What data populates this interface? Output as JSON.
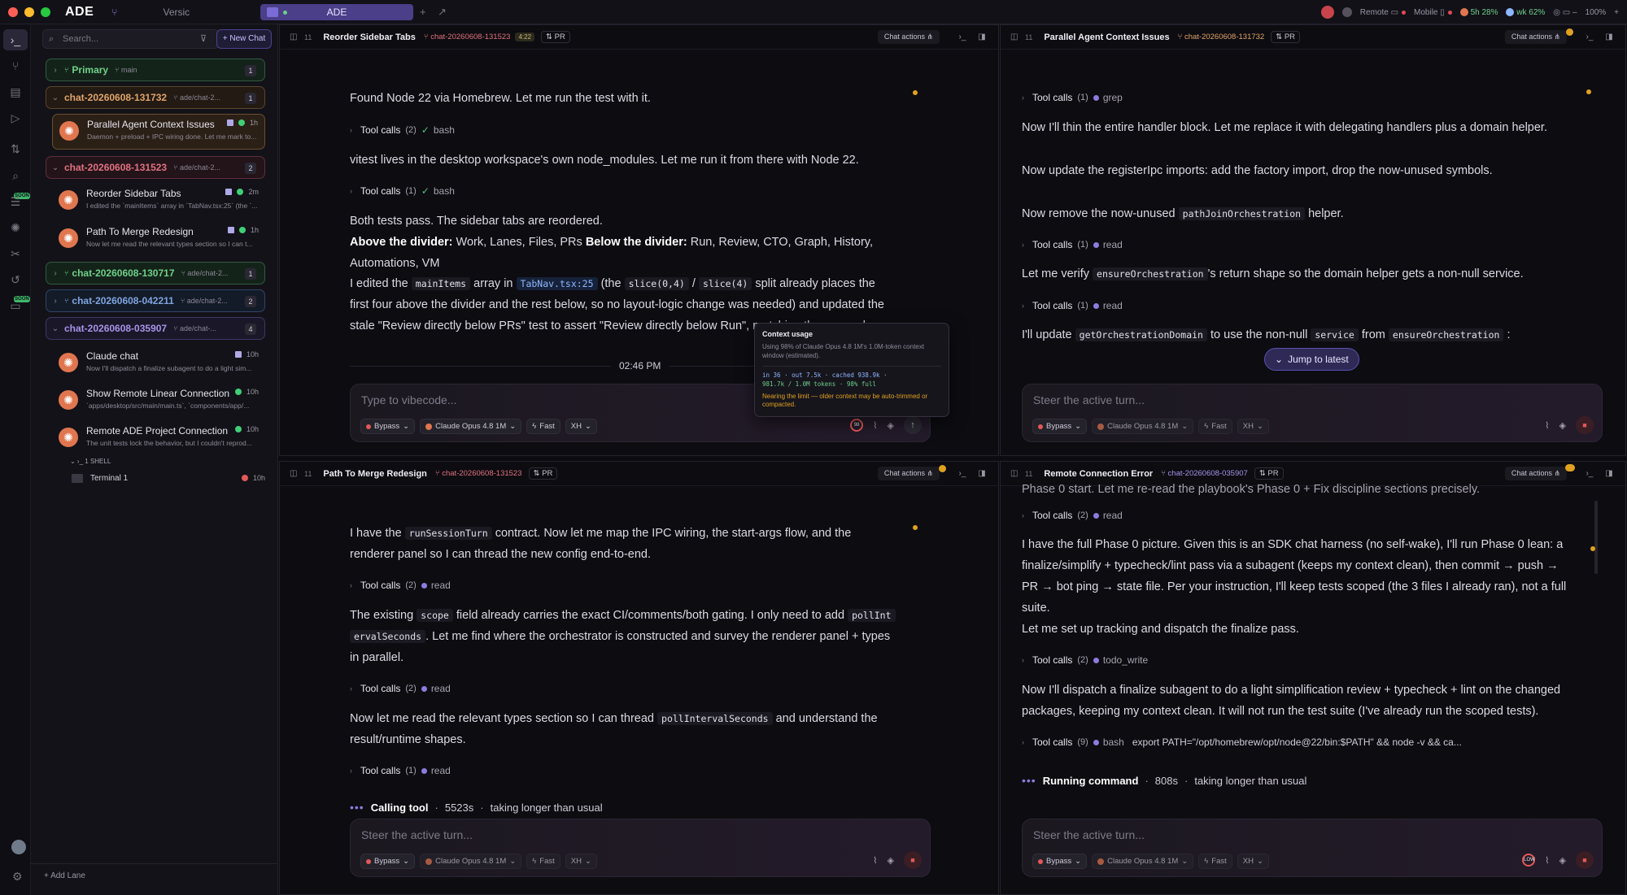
{
  "titlebar": {
    "app_name": "ADE",
    "workspace": "Versic",
    "center_tab": "ADE",
    "remote_label": "Remote",
    "mobile_label": "Mobile",
    "usage_a": "5h 28%",
    "usage_b": "wk 62%",
    "zoom": "100%"
  },
  "activity_tags": [
    "SOON",
    "SOON"
  ],
  "sidebar": {
    "search_placeholder": "Search...",
    "new_chat": "New Chat",
    "lanes": [
      {
        "name": "Primary",
        "sub": "main",
        "count": "1",
        "color": "#6ed089"
      },
      {
        "name": "chat-20260608-131732",
        "sub": "ade/chat-2...",
        "count": "1",
        "color": "#e0a46a"
      },
      {
        "name": "chat-20260608-131523",
        "sub": "ade/chat-2...",
        "count": "2",
        "color": "#e0727f"
      },
      {
        "name": "chat-20260608-130717",
        "sub": "ade/chat-2...",
        "count": "1",
        "color": "#6ed089"
      },
      {
        "name": "chat-20260608-042211",
        "sub": "ade/chat-2...",
        "count": "2",
        "color": "#7ea4e0"
      },
      {
        "name": "chat-20260608-035907",
        "sub": "ade/chat-...",
        "count": "4",
        "color": "#a694e8"
      }
    ],
    "chats": [
      {
        "title": "Parallel Agent Context Issues",
        "preview": "Daemon + preload + IPC wiring done. Let me mark to...",
        "time": "1h"
      },
      {
        "title": "Reorder Sidebar Tabs",
        "preview": "I edited the `mainItems` array in `TabNav.tsx:25` (the `...",
        "time": "2m"
      },
      {
        "title": "Path To Merge Redesign",
        "preview": "Now let me read the relevant types section so I can t...",
        "time": "1h"
      },
      {
        "title": "Claude chat",
        "preview": "Now I'll dispatch a finalize subagent to do a light sim...",
        "time": "10h"
      },
      {
        "title": "Show Remote Linear Connection",
        "preview": "`apps/desktop/src/main/main.ts`, `components/app/...",
        "time": "10h"
      },
      {
        "title": "Remote ADE Project Connection",
        "preview": "The unit tests lock the behavior, but I couldn't reprod...",
        "time": "10h"
      }
    ],
    "shell_label": "1 SHELL",
    "terminal": {
      "name": "Terminal 1",
      "time": "10h"
    },
    "add_lane": "Add Lane"
  },
  "panes": {
    "tl": {
      "title": "Reorder Sidebar Tabs",
      "branch": "chat-20260608-131523",
      "timer": "4:22",
      "pr": "PR",
      "actions": "Chat actions",
      "num": "11",
      "line1": "Found Node 22 via Homebrew. Let me run the test with it.",
      "tool1": {
        "label": "Tool calls",
        "count": "(2)",
        "kind": "bash"
      },
      "line2": "vitest lives in the desktop workspace's own node_modules. Let me run it from there with Node 22.",
      "tool2": {
        "label": "Tool calls",
        "count": "(1)",
        "kind": "bash"
      },
      "line3": "Both tests pass. The sidebar tabs are reordered.",
      "l4a": "Above the divider:",
      "l4b": " Work, Lanes, Files, PRs ",
      "l4c": "Below the divider:",
      "l4d": " Run, Review, CTO, Graph, History,",
      "line5": "Automations, VM",
      "l6a": "I edited the",
      "l6b": "mainItems",
      "l6c": "array in",
      "l6d": "TabNav.tsx:25",
      "l6e": "(the",
      "l6f": "slice(0,4)",
      "l6g": "/",
      "l6h": "slice(4)",
      "l6i": "split already places the",
      "line7": "first four above the divider and the rest below, so no layout-logic change was needed) and updated the",
      "line8": "stale \"Review directly below PRs\" test to assert \"Review directly below Run\", matching the new order.",
      "timestamp": "02:46 PM",
      "placeholder": "Type to vibecode...",
      "ctx": "98"
    },
    "tr": {
      "title": "Parallel Agent Context Issues",
      "branch": "chat-20260608-131732",
      "pr": "PR",
      "actions": "Chat actions",
      "num": "11",
      "tool0": {
        "label": "Tool calls",
        "count": "(1)",
        "kind": "grep"
      },
      "line1": "Now I'll thin the entire handler block. Let me replace it with delegating handlers plus a domain helper.",
      "line2": "Now update the registerIpc imports: add the factory import, drop the now-unused symbols.",
      "l3a": "Now remove the now-unused",
      "l3b": "pathJoinOrchestration",
      "l3c": "helper.",
      "tool1": {
        "label": "Tool calls",
        "count": "(1)",
        "kind": "read"
      },
      "l4a": "Let me verify",
      "l4b": "ensureOrchestration",
      "l4c": "'s return shape so the domain helper gets a non-null service.",
      "tool2": {
        "label": "Tool calls",
        "count": "(1)",
        "kind": "read"
      },
      "l5a": "I'll update",
      "l5b": "getOrchestrationDomain",
      "l5c": "to use the non-null",
      "l5d": "service",
      "l5e": "from",
      "l5f": "ensureOrchestration",
      "l5g": ":",
      "jump": "Jump to latest",
      "placeholder": "Steer the active turn..."
    },
    "bl": {
      "title": "Path To Merge Redesign",
      "branch": "chat-20260608-131523",
      "pr": "PR",
      "actions": "Chat actions",
      "num": "11",
      "l1a": "I have the",
      "l1b": "runSessionTurn",
      "l1c": "contract. Now let me map the IPC wiring, the start-args flow, and the",
      "line2": "renderer panel so I can thread the new config end-to-end.",
      "tool1": {
        "label": "Tool calls",
        "count": "(2)",
        "kind": "read"
      },
      "l3a": "The existing",
      "l3b": "scope",
      "l3c": "field already carries the exact CI/comments/both gating. I only need to add",
      "l3d": "pollInt",
      "l4a": "ervalSeconds",
      "l4b": ". Let me find where the orchestrator is constructed and survey the renderer panel + types",
      "line5": "in parallel.",
      "tool2": {
        "label": "Tool calls",
        "count": "(2)",
        "kind": "read"
      },
      "l6a": "Now let me read the relevant types section so I can thread",
      "l6b": "pollIntervalSeconds",
      "l6c": "and understand the",
      "line7": "result/runtime shapes.",
      "tool3": {
        "label": "Tool calls",
        "count": "(1)",
        "kind": "read"
      },
      "status": "Calling tool",
      "status_time": "5523s",
      "status_note": "taking longer than usual",
      "placeholder": "Steer the active turn..."
    },
    "br": {
      "title": "Remote Connection Error",
      "branch": "chat-20260608-035907",
      "pr": "PR",
      "actions": "Chat actions",
      "num": "11",
      "line0": "Phase 0 start. Let me re-read the playbook's Phase 0 + Fix discipline sections precisely.",
      "tool1": {
        "label": "Tool calls",
        "count": "(2)",
        "kind": "read"
      },
      "line1": "I have the full Phase 0 picture. Given this is an SDK chat harness (no self-wake), I'll run Phase 0 lean: a",
      "line2": "finalize/simplify + typecheck/lint pass via a subagent (keeps my context clean), then commit → push →",
      "line3": "PR → bot ping → state file. Per your instruction, I'll keep tests scoped (the 3 files I already ran), not a full",
      "line4": "suite.",
      "line5": "Let me set up tracking and dispatch the finalize pass.",
      "tool2": {
        "label": "Tool calls",
        "count": "(2)",
        "kind": "todo_write"
      },
      "line6": "Now I'll dispatch a finalize subagent to do a light simplification review + typecheck + lint on the changed",
      "line7": "packages, keeping my context clean. It will not run the test suite (I've already run the scoped tests).",
      "tool3": {
        "label": "Tool calls",
        "count": "(9)",
        "kind": "bash",
        "cmd": "export PATH=\"/opt/homebrew/opt/node@22/bin:$PATH\" && node -v && ca..."
      },
      "status": "Running command",
      "status_time": "808s",
      "status_note": "taking longer than usual",
      "placeholder": "Steer the active turn...",
      "ctx": "LOW"
    }
  },
  "composer": {
    "mode": "Bypass",
    "model": "Claude Opus 4.8 1M",
    "speed": "Fast",
    "effort": "XH"
  },
  "tooltip": {
    "title": "Context usage",
    "desc": "Using 98% of Claude Opus 4.8 1M's 1.0M-token context window (estimated).",
    "stats": "in 36 · out 7.5k · cached 938.9k ·",
    "total": "981.7k / 1.0M tokens · 98% full",
    "warn": "Nearing the limit — older context may be auto-trimmed or compacted."
  },
  "colors": {
    "accent": "#7b6bd6",
    "danger": "#e25858",
    "ok": "#3fcf77",
    "warn": "#e0a11f"
  }
}
